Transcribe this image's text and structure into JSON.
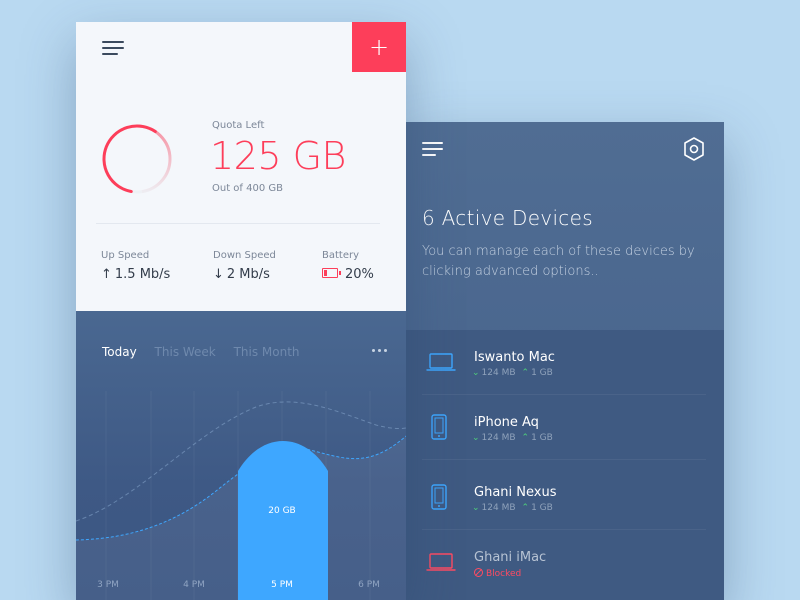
{
  "left_panel": {
    "add_label": "+",
    "quota": {
      "label": "Quota Left",
      "value": "125 GB",
      "total": "Out of 400 GB",
      "remaining_fraction": 0.3125,
      "accent": "#fd3e5a"
    },
    "stats": [
      {
        "label": "Up Speed",
        "arrow": "↑",
        "value": "1.5 Mb/s"
      },
      {
        "label": "Down Speed",
        "arrow": "↓",
        "value": "2 Mb/s"
      },
      {
        "label": "Battery",
        "value": "20%"
      }
    ],
    "tabs": [
      "Today",
      "This Week",
      "This Month"
    ],
    "active_tab": "Today",
    "colors": {
      "highlight": "#3ea7ff",
      "top_bg": "#f4f7fb"
    }
  },
  "chart_data": {
    "type": "area",
    "categories": [
      "3 PM",
      "4 PM",
      "5 PM",
      "6 PM"
    ],
    "highlight": {
      "category": "5 PM",
      "label": "20 GB"
    }
  },
  "right_panel": {
    "title": "6 Active Devices",
    "description": "You can manage each of these devices by clicking advanced options..",
    "devices": [
      {
        "name": "Iswanto Mac",
        "icon": "laptop-icon",
        "down": "124 MB",
        "up": "1 GB"
      },
      {
        "name": "iPhone Aq",
        "icon": "phone-icon",
        "down": "124 MB",
        "up": "1 GB"
      },
      {
        "name": "Ghani Nexus",
        "icon": "phone-icon",
        "down": "124 MB",
        "up": "1 GB"
      },
      {
        "name": "Ghani iMac",
        "icon": "laptop-icon",
        "status": "Blocked"
      }
    ],
    "colors": {
      "device_icon": "#3ea7ff",
      "blocked": "#ff4b62",
      "positive": "#4ed07a"
    }
  }
}
